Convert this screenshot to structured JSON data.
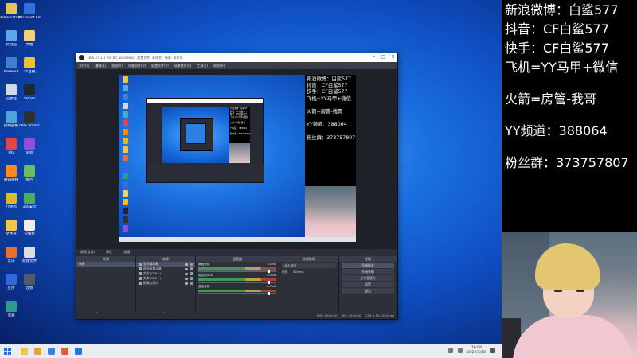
{
  "desktop": {
    "icons_col1": [
      {
        "label": "Administrator",
        "color": "#e8c25a"
      },
      {
        "label": "此电脑",
        "color": "#5aa7e8"
      },
      {
        "label": "Network",
        "color": "#3e7fd0"
      },
      {
        "label": "回收站",
        "color": "#cfd8e3"
      },
      {
        "label": "控制面板",
        "color": "#4ea3d8"
      },
      {
        "label": "QQ",
        "color": "#e04646"
      },
      {
        "label": "腾讯视频",
        "color": "#ff8a1c"
      },
      {
        "label": "YY语音",
        "color": "#e2b52a"
      },
      {
        "label": "文件夹",
        "color": "#f0c44c"
      },
      {
        "label": "音乐",
        "color": "#e96d2b"
      },
      {
        "label": "应用",
        "color": "#3567d8"
      },
      {
        "label": "设置",
        "color": "#2a9d8f"
      }
    ],
    "icons_col2": [
      {
        "label": "Microsoft Edge",
        "color": "#2f6fe0"
      },
      {
        "label": "文档",
        "color": "#f0d070"
      },
      {
        "label": "YY直播",
        "color": "#f0c030"
      },
      {
        "label": "Steam",
        "color": "#1b2838"
      },
      {
        "label": "OBS Studio",
        "color": "#303030"
      },
      {
        "label": "游戏",
        "color": "#8f4fd8"
      },
      {
        "label": "图片",
        "color": "#6cbf5a"
      },
      {
        "label": "360安全",
        "color": "#4caf50"
      },
      {
        "label": "记事本",
        "color": "#eeeeee"
      },
      {
        "label": "新建文件",
        "color": "#dddddd"
      },
      {
        "label": "音频",
        "color": "#555a66"
      }
    ]
  },
  "taskbar": {
    "apps": [
      "#f0c44c",
      "#e8a23a",
      "#3f7fe0",
      "#e55b3c",
      "#2f6fe0"
    ],
    "time": "16:08",
    "date": "2022/3/18"
  },
  "obs": {
    "title": "OBS 27.1.3 (64-bit, windows) - 配置文件: 未命名 - 场景: 未命名",
    "menu": [
      "文件(F)",
      "编辑(E)",
      "视图(V)",
      "停靠部件(D)",
      "配置文件(P)",
      "场景集合(S)",
      "工具(T)",
      "帮助(H)"
    ],
    "scene_bar": [
      "场景(当前)",
      "属性",
      "滤镜"
    ],
    "docks": {
      "scenes": {
        "title": "场景",
        "items": [
          "场景"
        ]
      },
      "sources": {
        "title": "来源",
        "items": [
          "显示器采集",
          "视频采集设备",
          "文本 (GDI+)",
          "文本 (GDI+)",
          "图像幻灯片"
        ]
      },
      "mixer": {
        "title": "混音器",
        "channels": [
          {
            "name": "桌面音频",
            "db": "0.0 dB"
          },
          {
            "name": "麦克风/Aux",
            "db": "0.0 dB"
          },
          {
            "name": "桌面音频",
            "db": "-0.7 dB"
          }
        ]
      },
      "transitions": {
        "title": "场景转场",
        "type": "淡入淡出",
        "duration_label": "时长",
        "duration": "300 ms"
      },
      "controls": {
        "title": "控制",
        "buttons": [
          "开始推流",
          "开始录制",
          "工作室模式",
          "设置",
          "退出"
        ]
      }
    },
    "status": [
      "LIVE: 00:00:00",
      "REC: 00:00:00",
      "CPU: 1.1%, 30.00 fps"
    ]
  },
  "overlay_lines": [
    "新浪微博：白鲨577",
    "抖音：CF白鲨577",
    "快手：CF白鲨577",
    "飞机=YY马甲+微信",
    "火箭=房管-我哥",
    "YY频道：388064",
    "粉丝群：373757807"
  ]
}
